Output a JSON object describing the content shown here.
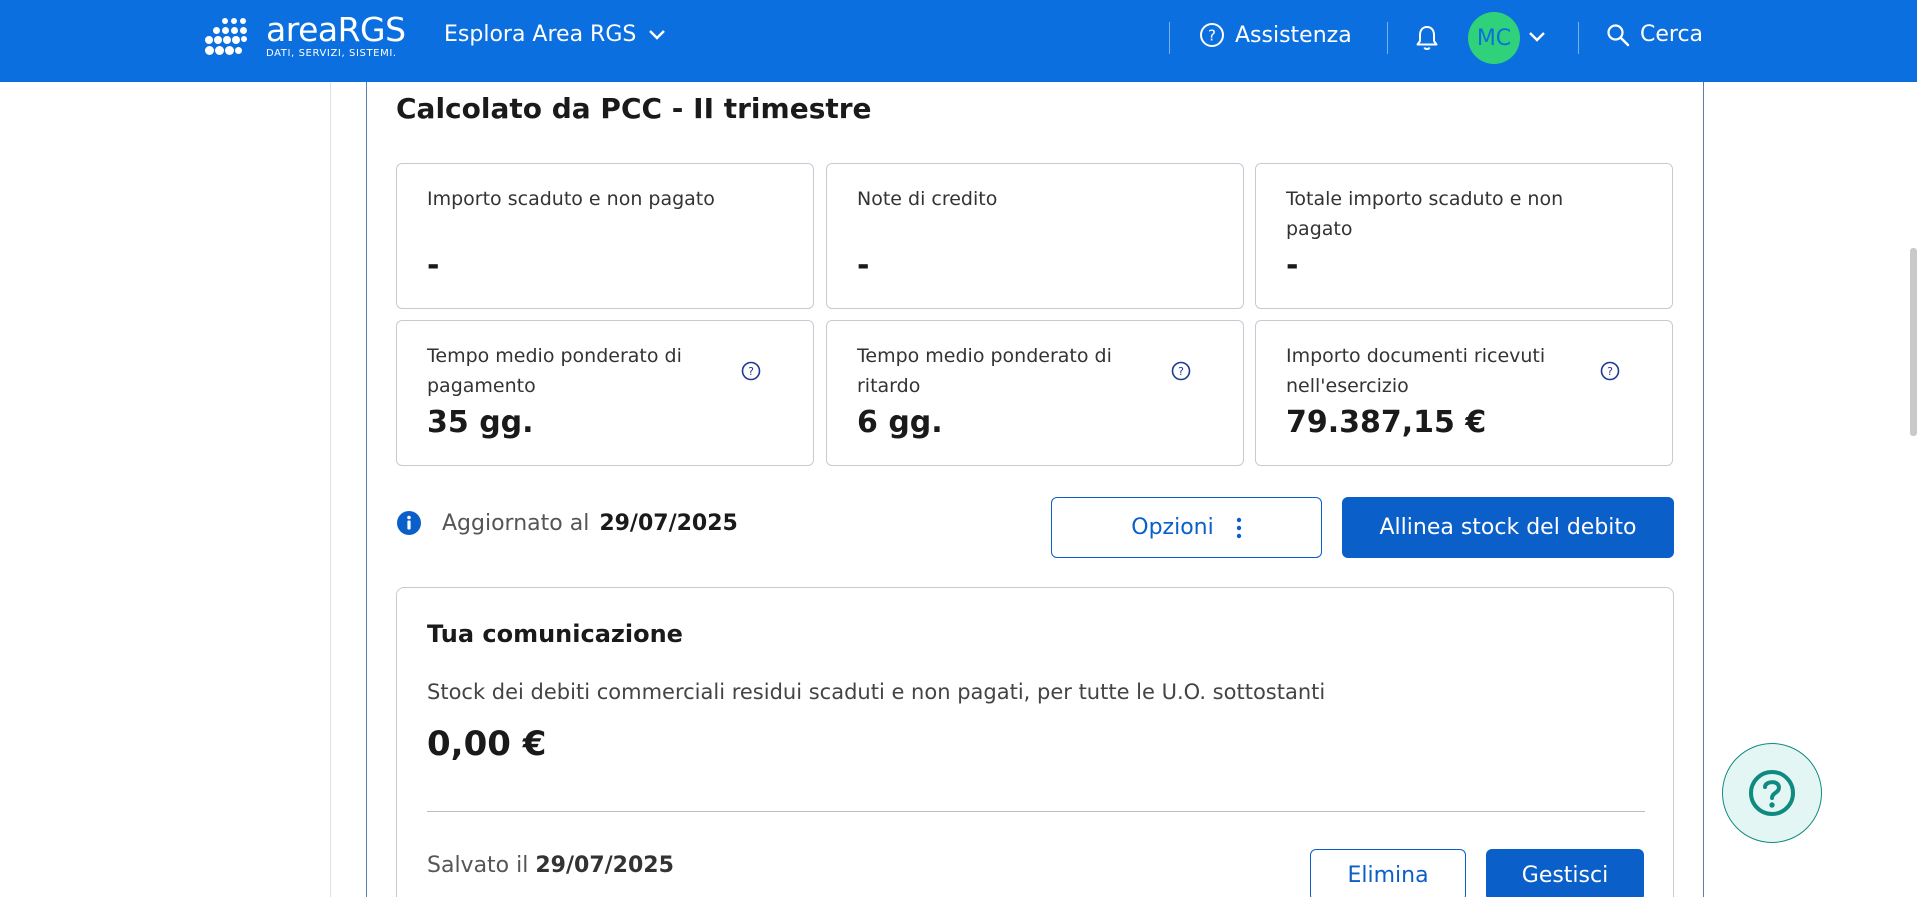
{
  "header": {
    "logo_title": "areaRGS",
    "logo_subtitle": "DATI, SERVIZI, SISTEMI.",
    "explore_label": "Esplora Area RGS",
    "help_label": "Assistenza",
    "user_initials": "MC",
    "search_label": "Cerca",
    "colors": {
      "bar": "#0b6fe0",
      "avatar": "#2fd27a"
    }
  },
  "section": {
    "title": "Calcolato da PCC - II trimestre",
    "cards": [
      {
        "label": "Importo scaduto e non pagato",
        "value": "-",
        "has_help": false
      },
      {
        "label": "Note di credito",
        "value": "-",
        "has_help": false
      },
      {
        "label": "Totale importo scaduto e non pagato",
        "value": "-",
        "has_help": false
      },
      {
        "label": "Tempo medio ponderato di pagamento",
        "value": "35 gg.",
        "has_help": true,
        "help_icon": "question-circle-icon"
      },
      {
        "label": "Tempo medio ponderato di ritardo",
        "value": "6 gg.",
        "has_help": true,
        "help_icon": "question-circle-icon"
      },
      {
        "label": "Importo documenti ricevuti nell'esercizio",
        "value": "79.387,15 €",
        "has_help": true,
        "help_icon": "question-circle-icon"
      }
    ],
    "updated_label": "Aggiornato al",
    "updated_date": "29/07/2025",
    "options_button": "Opzioni",
    "align_button": "Allinea stock del debito"
  },
  "communication": {
    "title": "Tua comunicazione",
    "description": "Stock dei debiti commerciali residui scaduti e non pagati, per tutte le U.O. sottostanti",
    "value": "0,00 €",
    "saved_label": "Salvato il",
    "saved_date": "29/07/2025",
    "delete_button": "Elimina",
    "manage_button": "Gestisci"
  },
  "theme": {
    "primary": "#0b5fc9",
    "fab_bg": "#e4f6f3",
    "fab_accent": "#0f8a80"
  }
}
